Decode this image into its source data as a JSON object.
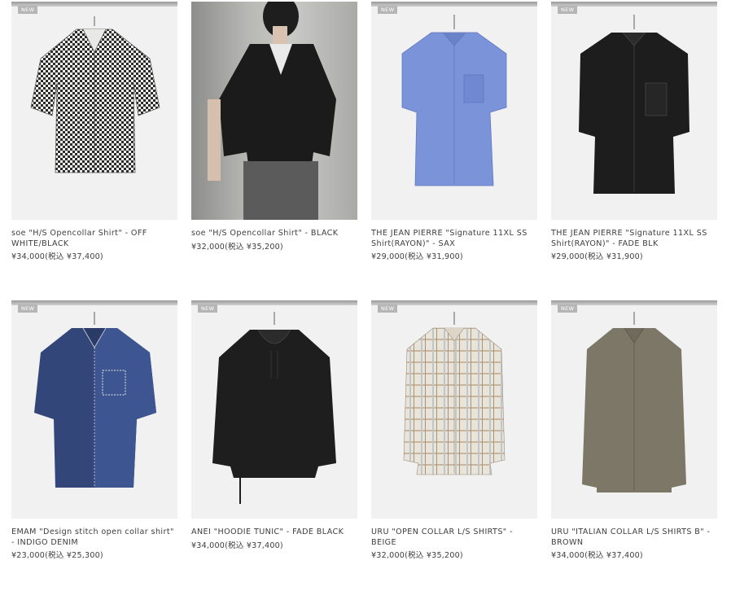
{
  "badge_label": "NEW",
  "products": [
    {
      "title": "soe \"H/S Opencollar Shirt\" - OFF WHITE/BLACK",
      "price": "¥34,000(税込 ¥37,400)"
    },
    {
      "title": "soe \"H/S Opencollar Shirt\" - BLACK",
      "price": "¥32,000(税込 ¥35,200)"
    },
    {
      "title": "THE JEAN PIERRE \"Signature 11XL SS Shirt(RAYON)\" - SAX",
      "price": "¥29,000(税込 ¥31,900)"
    },
    {
      "title": "THE JEAN PIERRE \"Signature 11XL SS Shirt(RAYON)\" - FADE BLK",
      "price": "¥29,000(税込 ¥31,900)"
    },
    {
      "title": "EMAM \"Design stitch open collar shirt\" - INDIGO DENIM",
      "price": "¥23,000(税込 ¥25,300)"
    },
    {
      "title": "ANEI \"HOODIE TUNIC\" - FADE BLACK",
      "price": "¥34,000(税込 ¥37,400)"
    },
    {
      "title": "URU \"OPEN COLLAR L/S SHIRTS\" - BEIGE",
      "price": "¥32,000(税込 ¥35,200)"
    },
    {
      "title": "URU \"ITALIAN COLLAR L/S SHIRTS B\" - BROWN",
      "price": "¥34,000(税込 ¥37,400)"
    }
  ]
}
